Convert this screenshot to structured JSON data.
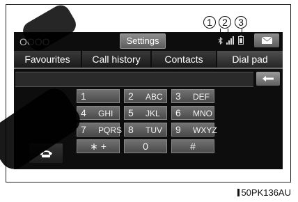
{
  "status_bar": {
    "circles": "OOOO",
    "settings_label": "Settings",
    "icons": [
      "bluetooth-icon",
      "signal-icon",
      "battery-icon",
      "mail-icon"
    ]
  },
  "callouts": [
    "1",
    "2",
    "3"
  ],
  "tabs": [
    {
      "label": "Favourites"
    },
    {
      "label": "Call history"
    },
    {
      "label": "Contacts"
    },
    {
      "label": "Dial pad"
    }
  ],
  "keypad": [
    {
      "num": "1",
      "letters": ""
    },
    {
      "num": "2",
      "letters": "ABC"
    },
    {
      "num": "3",
      "letters": "DEF"
    },
    {
      "num": "4",
      "letters": "GHI"
    },
    {
      "num": "5",
      "letters": "JKL"
    },
    {
      "num": "6",
      "letters": "MNO"
    },
    {
      "num": "7",
      "letters": "PQRS"
    },
    {
      "num": "8",
      "letters": "TUV"
    },
    {
      "num": "9",
      "letters": "WXYZ"
    },
    {
      "num": "∗ +",
      "letters": ""
    },
    {
      "num": "0",
      "letters": ""
    },
    {
      "num": "#",
      "letters": ""
    }
  ],
  "figure_id": "50PK136AU"
}
